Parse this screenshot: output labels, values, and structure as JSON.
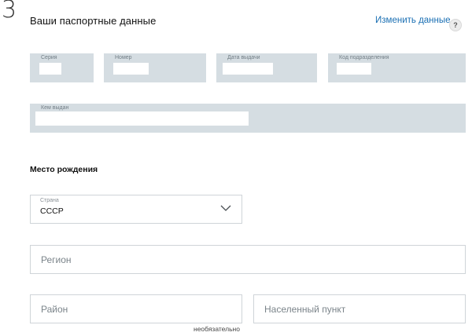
{
  "step": {
    "number": "3"
  },
  "header": {
    "title": "Ваши паспортные данные",
    "change_link": "Изменить данные",
    "help_icon": "?"
  },
  "passport": {
    "series_label": "Серия",
    "number_label": "Номер",
    "issue_date_label": "Дата выдачи",
    "division_code_label": "Код подразделения",
    "issued_by_label": "Кем выдан"
  },
  "birthplace": {
    "title": "Место рождения",
    "country": {
      "label": "Страна",
      "value": "СССР"
    },
    "region_placeholder": "Регион",
    "district_placeholder": "Район",
    "locality_placeholder": "Населенный пункт",
    "optional_note": "необязательно"
  },
  "icons": {
    "dropdown": "chevron-down-icon",
    "help": "question-circle-icon"
  },
  "colors": {
    "link": "#1a6fb3",
    "readonly_field": "#d5dde2"
  }
}
